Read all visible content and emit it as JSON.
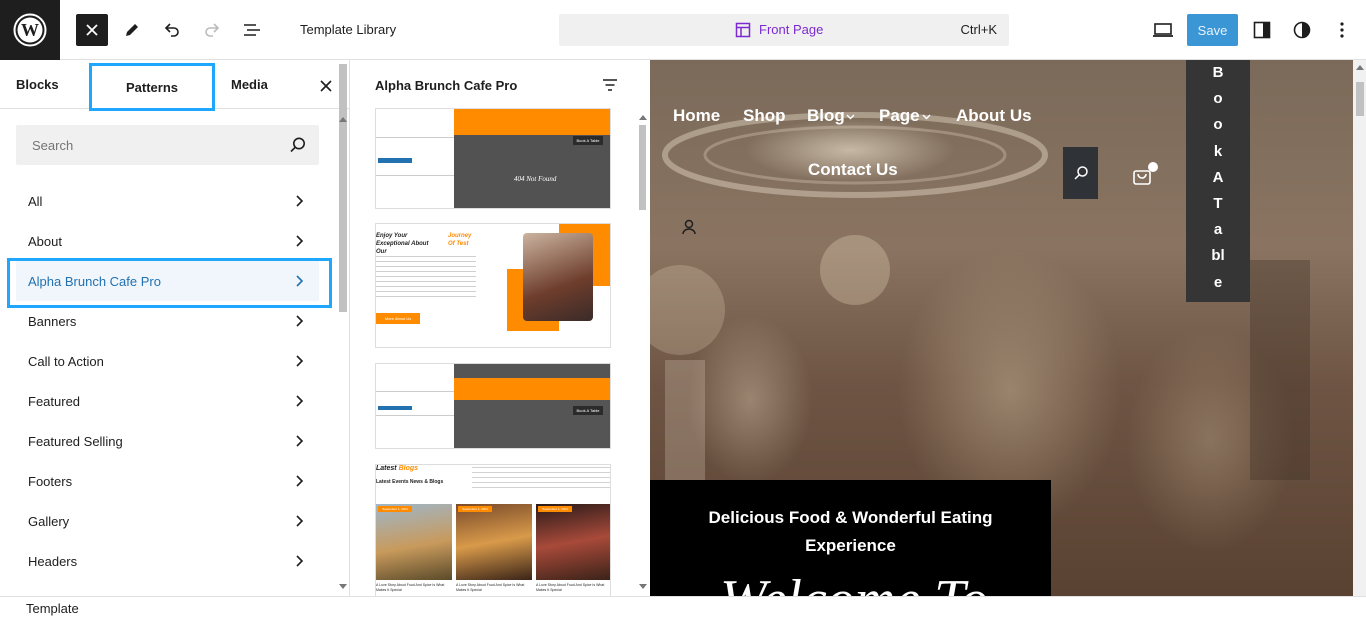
{
  "header": {
    "document_title": "Template Library",
    "command_bar": {
      "title": "Front Page",
      "shortcut": "Ctrl+K"
    },
    "save_label": "Save"
  },
  "inserter": {
    "tabs": [
      "Blocks",
      "Patterns",
      "Media"
    ],
    "search_placeholder": "Search",
    "categories": [
      "All",
      "About",
      "Alpha Brunch Cafe Pro",
      "Banners",
      "Call to Action",
      "Featured",
      "Featured Selling",
      "Footers",
      "Gallery",
      "Headers"
    ],
    "selected_category": "Alpha Brunch Cafe Pro"
  },
  "patterns_panel": {
    "title": "Alpha Brunch Cafe Pro",
    "thumb1": {
      "label": "404 Not Found",
      "button": "Book A Table"
    },
    "thumb2": {
      "heading_a": "Enjoy Your",
      "heading_b": "Exceptional About Our",
      "heading_accent": "Journey Of Test",
      "cta": "More About Us"
    },
    "thumb3": {
      "button": "Book A Table"
    },
    "thumb4": {
      "heading": "Latest",
      "heading_accent": "Blogs",
      "subheading": "Latest Events News & Blogs",
      "date": "September 1, 2024",
      "post_titles": [
        "A Love Story About Food And Spice Is What Makes It Special",
        "A Love Story About Food And Spice Is What Makes It Special",
        "A Love Story About Food And Spice Is What Makes It Special"
      ]
    }
  },
  "canvas": {
    "nav": [
      "Home",
      "Shop",
      "Blog",
      "Page",
      "About Us",
      "Contact Us"
    ],
    "book_table": [
      "B",
      "o",
      "o",
      "k",
      "A",
      "T",
      "a",
      "bl",
      "e"
    ],
    "hero_text": "Delicious Food & Wonderful Eating Experience",
    "hero_script": "Welcome To"
  },
  "footer": {
    "label": "Template"
  },
  "colors": {
    "accent_orange": "#ff8c00",
    "save_blue": "#3b96d6",
    "highlight_blue": "#1ea7fd",
    "command_purple": "#7b2ad1"
  }
}
